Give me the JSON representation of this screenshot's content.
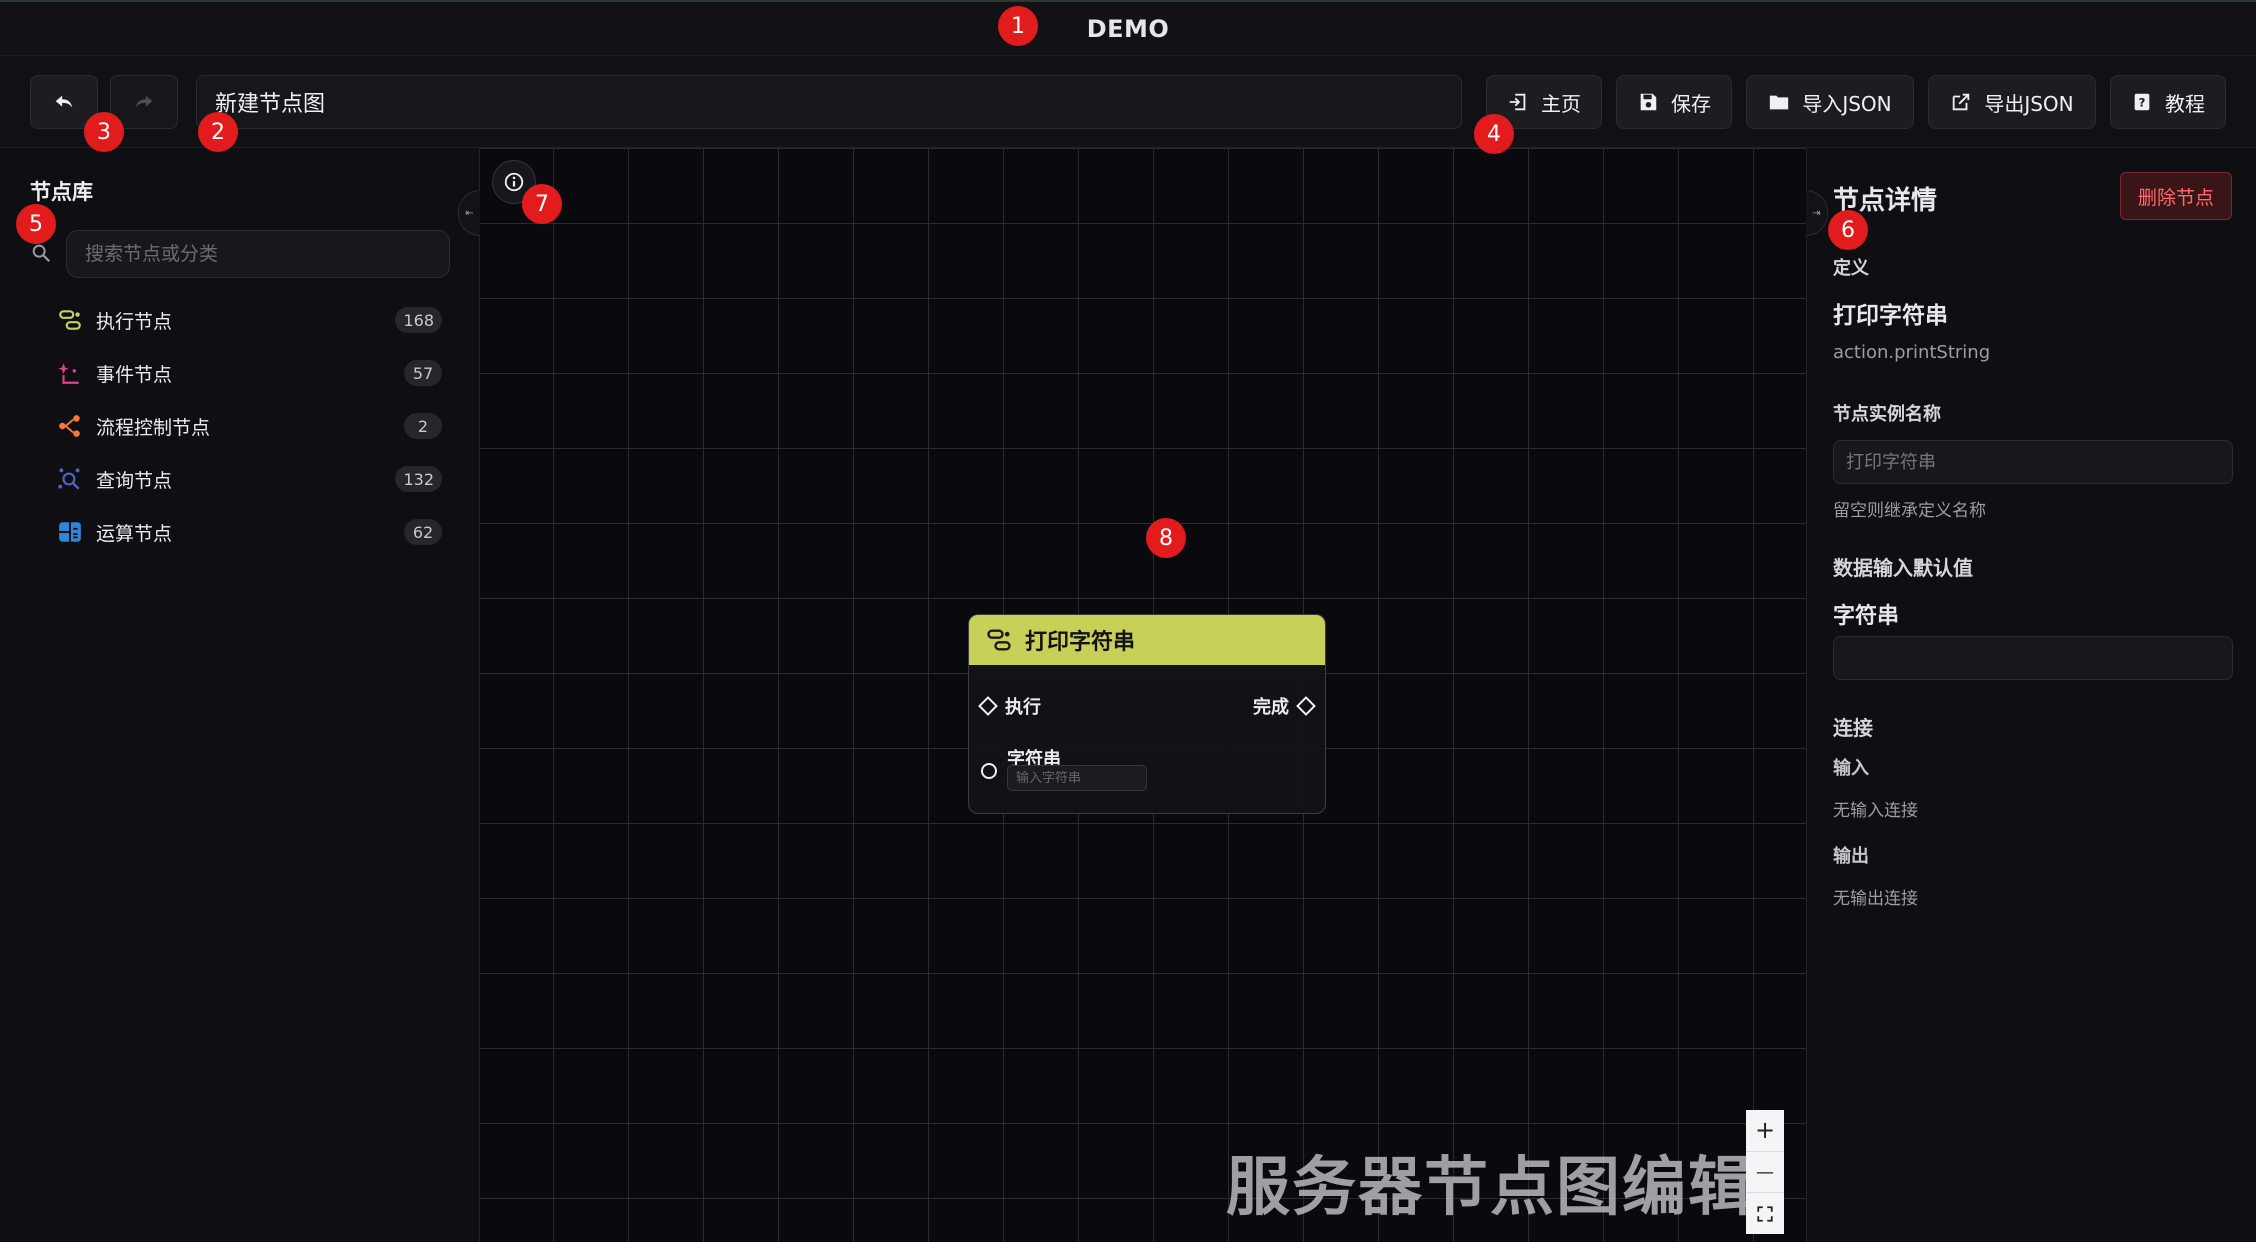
{
  "app": {
    "title": "DEMO"
  },
  "toolbar": {
    "undo_icon": "undo-arrow-icon",
    "redo_icon": "redo-arrow-icon",
    "graph_name": "新建节点图",
    "home_label": "主页",
    "save_label": "保存",
    "import_label": "导入JSON",
    "export_label": "导出JSON",
    "tutorial_label": "教程"
  },
  "library": {
    "title": "节点库",
    "search_placeholder": "搜索节点或分类",
    "categories": [
      {
        "label": "执行节点",
        "count": "168",
        "icon": "action-node-icon",
        "color": "#c5d160"
      },
      {
        "label": "事件节点",
        "count": "57",
        "icon": "event-node-icon",
        "color": "#e0408c"
      },
      {
        "label": "流程控制节点",
        "count": "2",
        "icon": "flow-control-icon",
        "color": "#f07a3a"
      },
      {
        "label": "查询节点",
        "count": "132",
        "icon": "query-node-icon",
        "color": "#4f62c9"
      },
      {
        "label": "运算节点",
        "count": "62",
        "icon": "operation-node-icon",
        "color": "#2f86d8"
      }
    ]
  },
  "canvas": {
    "node": {
      "title": "打印字符串",
      "header_color": "#c7d158",
      "exec_in_label": "执行",
      "exec_out_label": "完成",
      "string_label": "字符串",
      "string_placeholder": "输入字符串"
    },
    "zoom": {
      "in": "+",
      "out": "—",
      "fit": "fit-view-icon"
    },
    "watermark": "服务器节点图编辑"
  },
  "details": {
    "title": "节点详情",
    "delete_label": "删除节点",
    "definition_heading": "定义",
    "definition_name": "打印字符串",
    "definition_id": "action.printString",
    "instance_name_label": "节点实例名称",
    "instance_name_placeholder": "打印字符串",
    "instance_name_hint": "留空则继承定义名称",
    "defaults_heading": "数据输入默认值",
    "string_field_label": "字符串",
    "string_field_value": "",
    "connections_heading": "连接",
    "inputs_label": "输入",
    "no_inputs": "无输入连接",
    "outputs_label": "输出",
    "no_outputs": "无输出连接"
  },
  "annotations": [
    "1",
    "2",
    "3",
    "4",
    "5",
    "6",
    "7",
    "8"
  ]
}
